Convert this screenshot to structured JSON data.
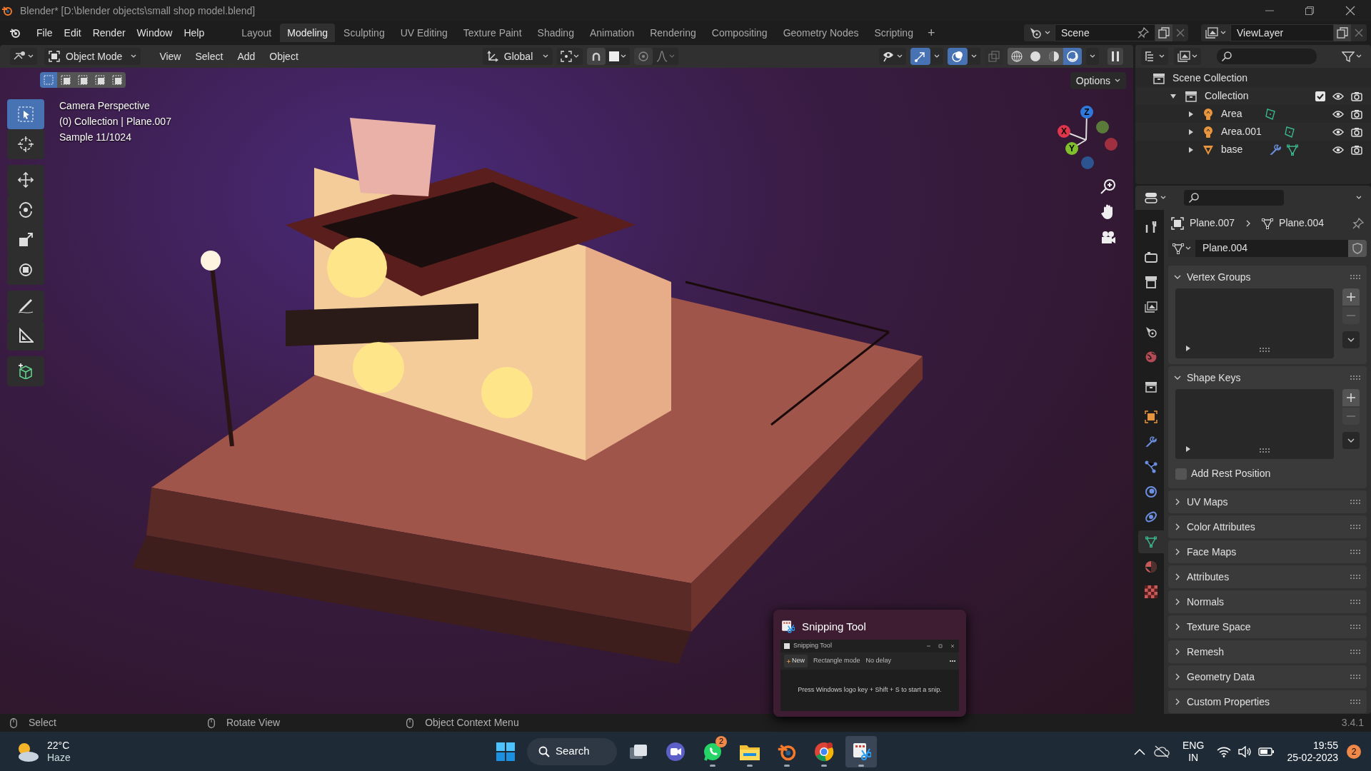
{
  "window": {
    "title": "Blender* [D:\\blender objects\\small shop model.blend]"
  },
  "menu": [
    "File",
    "Edit",
    "Render",
    "Window",
    "Help"
  ],
  "workspaces": [
    {
      "label": "Layout",
      "selected": false
    },
    {
      "label": "Modeling",
      "selected": true
    },
    {
      "label": "Sculpting",
      "selected": false
    },
    {
      "label": "UV Editing",
      "selected": false
    },
    {
      "label": "Texture Paint",
      "selected": false
    },
    {
      "label": "Shading",
      "selected": false
    },
    {
      "label": "Animation",
      "selected": false
    },
    {
      "label": "Rendering",
      "selected": false
    },
    {
      "label": "Compositing",
      "selected": false
    },
    {
      "label": "Geometry Nodes",
      "selected": false
    },
    {
      "label": "Scripting",
      "selected": false
    }
  ],
  "add_workspace": "+",
  "scene": "Scene",
  "view_layer": "ViewLayer",
  "header": {
    "mode": "Object Mode",
    "menus": [
      "View",
      "Select",
      "Add",
      "Object"
    ],
    "orientation": "Global",
    "options": "Options",
    "select_modes": [
      {
        "selected": true
      },
      {
        "selected": false
      },
      {
        "selected": false
      },
      {
        "selected": false
      },
      {
        "selected": false
      }
    ],
    "shading": [
      {
        "kind": "wireframe",
        "selected": false
      },
      {
        "kind": "solid",
        "selected": false
      },
      {
        "kind": "material",
        "selected": false
      },
      {
        "kind": "rendered",
        "selected": true
      }
    ]
  },
  "viewport": {
    "info": [
      "Camera Perspective",
      "(0) Collection | Plane.007",
      "Sample 11/1024"
    ],
    "axes": [
      "X",
      "Y",
      "Z"
    ]
  },
  "tools": [
    {
      "kind": "select",
      "selected": true
    },
    {
      "kind": "cursor",
      "selected": false
    },
    {
      "kind": "move",
      "selected": false
    },
    {
      "kind": "rotate",
      "selected": false
    },
    {
      "kind": "scale",
      "selected": false
    },
    {
      "kind": "transform",
      "selected": false
    },
    {
      "kind": "annotate",
      "selected": false
    },
    {
      "kind": "measure",
      "selected": false
    },
    {
      "kind": "add_cube",
      "selected": false
    }
  ],
  "outliner": {
    "items": [
      {
        "label": "Scene Collection",
        "kind": "scene",
        "children": [
          {
            "label": "Collection",
            "kind": "collection",
            "expanded": true,
            "checked": true,
            "children": [
              {
                "label": "Area",
                "kind": "light",
                "expanded": false
              },
              {
                "label": "Area.001",
                "kind": "light",
                "expanded": false
              },
              {
                "label": "base",
                "kind": "mesh",
                "expanded": false
              }
            ]
          }
        ]
      }
    ]
  },
  "properties": {
    "breadcrumb": [
      "Plane.007",
      "Plane.004"
    ],
    "data_name": "Plane.004",
    "tabs": [
      {
        "kind": "tool",
        "selected": false
      },
      {
        "kind": "render",
        "selected": false
      },
      {
        "kind": "output",
        "selected": false
      },
      {
        "kind": "view_layer",
        "selected": false
      },
      {
        "kind": "scene",
        "selected": false
      },
      {
        "kind": "world",
        "selected": false
      },
      {
        "kind": "collection",
        "selected": false
      },
      {
        "kind": "object",
        "selected": false
      },
      {
        "kind": "modifiers",
        "selected": false
      },
      {
        "kind": "particles",
        "selected": false
      },
      {
        "kind": "physics",
        "selected": false
      },
      {
        "kind": "constraints",
        "selected": false
      },
      {
        "kind": "data",
        "selected": true
      },
      {
        "kind": "material",
        "selected": false
      },
      {
        "kind": "texture",
        "selected": false
      }
    ],
    "panels": [
      {
        "label": "Vertex Groups",
        "expanded": true,
        "kind": "list"
      },
      {
        "label": "Shape Keys",
        "expanded": true,
        "kind": "list",
        "option": {
          "label": "Add Rest Position",
          "checked": false
        }
      },
      {
        "label": "UV Maps",
        "expanded": false
      },
      {
        "label": "Color Attributes",
        "expanded": false
      },
      {
        "label": "Face Maps",
        "expanded": false
      },
      {
        "label": "Attributes",
        "expanded": false
      },
      {
        "label": "Normals",
        "expanded": false
      },
      {
        "label": "Texture Space",
        "expanded": false
      },
      {
        "label": "Remesh",
        "expanded": false
      },
      {
        "label": "Geometry Data",
        "expanded": false
      },
      {
        "label": "Custom Properties",
        "expanded": false
      }
    ]
  },
  "status_bar": {
    "hints": [
      "Select",
      "Rotate View",
      "Object Context Menu"
    ],
    "version": "3.4.1"
  },
  "snip_preview": {
    "title": "Snipping Tool",
    "window_title": "Snipping Tool",
    "new": "New",
    "mode": "Rectangle mode",
    "delay": "No delay",
    "hint": "Press Windows logo key + Shift + S to start a snip."
  },
  "taskbar": {
    "temperature": "22°C",
    "condition": "Haze",
    "search": "Search",
    "apps": [
      {
        "kind": "task_view",
        "running": false,
        "selected": false
      },
      {
        "kind": "meet",
        "running": false,
        "selected": false
      },
      {
        "kind": "whatsapp",
        "running": true,
        "selected": false,
        "badge": "2"
      },
      {
        "kind": "explorer",
        "running": true,
        "selected": false
      },
      {
        "kind": "blender",
        "running": true,
        "selected": false
      },
      {
        "kind": "chrome",
        "running": true,
        "selected": false
      },
      {
        "kind": "snipping",
        "running": true,
        "selected": true
      }
    ],
    "language": "ENG",
    "region": "IN",
    "time": "19:55",
    "date": "25-02-2023",
    "notifications": "2"
  }
}
